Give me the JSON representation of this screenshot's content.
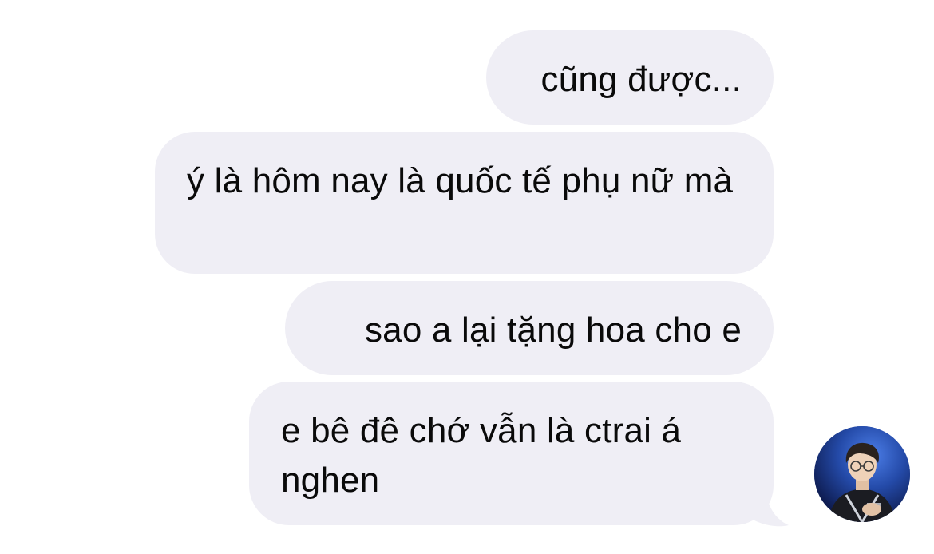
{
  "messages": [
    {
      "text": "cũng được..."
    },
    {
      "text": "ý là hôm nay là quốc tế phụ nữ mà"
    },
    {
      "text": "sao a lại tặng hoa cho e"
    },
    {
      "text": "e bê đê chớ vẫn là ctrai á nghen"
    }
  ],
  "colors": {
    "bubble_background": "#efeef5",
    "text": "#0a0a0a",
    "page_background": "#ffffff"
  },
  "avatar": {
    "icon": "user-photo-icon"
  }
}
